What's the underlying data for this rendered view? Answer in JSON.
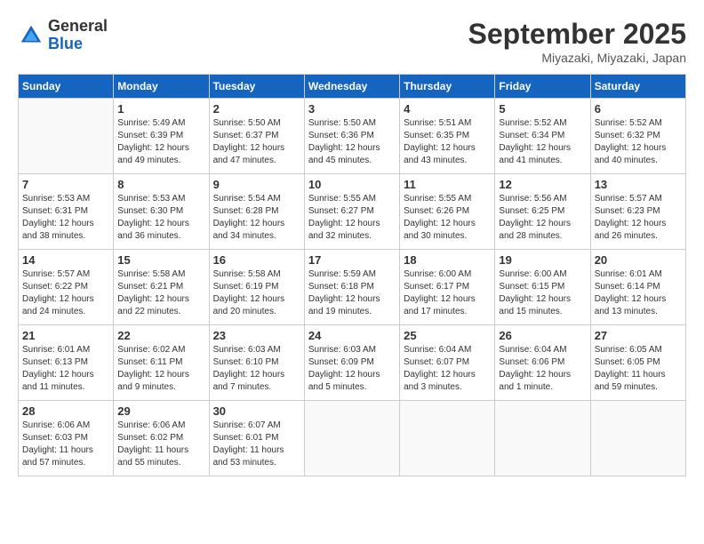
{
  "header": {
    "logo_general": "General",
    "logo_blue": "Blue",
    "month_title": "September 2025",
    "location": "Miyazaki, Miyazaki, Japan"
  },
  "weekdays": [
    "Sunday",
    "Monday",
    "Tuesday",
    "Wednesday",
    "Thursday",
    "Friday",
    "Saturday"
  ],
  "weeks": [
    [
      {
        "day": "",
        "info": ""
      },
      {
        "day": "1",
        "info": "Sunrise: 5:49 AM\nSunset: 6:39 PM\nDaylight: 12 hours\nand 49 minutes."
      },
      {
        "day": "2",
        "info": "Sunrise: 5:50 AM\nSunset: 6:37 PM\nDaylight: 12 hours\nand 47 minutes."
      },
      {
        "day": "3",
        "info": "Sunrise: 5:50 AM\nSunset: 6:36 PM\nDaylight: 12 hours\nand 45 minutes."
      },
      {
        "day": "4",
        "info": "Sunrise: 5:51 AM\nSunset: 6:35 PM\nDaylight: 12 hours\nand 43 minutes."
      },
      {
        "day": "5",
        "info": "Sunrise: 5:52 AM\nSunset: 6:34 PM\nDaylight: 12 hours\nand 41 minutes."
      },
      {
        "day": "6",
        "info": "Sunrise: 5:52 AM\nSunset: 6:32 PM\nDaylight: 12 hours\nand 40 minutes."
      }
    ],
    [
      {
        "day": "7",
        "info": "Sunrise: 5:53 AM\nSunset: 6:31 PM\nDaylight: 12 hours\nand 38 minutes."
      },
      {
        "day": "8",
        "info": "Sunrise: 5:53 AM\nSunset: 6:30 PM\nDaylight: 12 hours\nand 36 minutes."
      },
      {
        "day": "9",
        "info": "Sunrise: 5:54 AM\nSunset: 6:28 PM\nDaylight: 12 hours\nand 34 minutes."
      },
      {
        "day": "10",
        "info": "Sunrise: 5:55 AM\nSunset: 6:27 PM\nDaylight: 12 hours\nand 32 minutes."
      },
      {
        "day": "11",
        "info": "Sunrise: 5:55 AM\nSunset: 6:26 PM\nDaylight: 12 hours\nand 30 minutes."
      },
      {
        "day": "12",
        "info": "Sunrise: 5:56 AM\nSunset: 6:25 PM\nDaylight: 12 hours\nand 28 minutes."
      },
      {
        "day": "13",
        "info": "Sunrise: 5:57 AM\nSunset: 6:23 PM\nDaylight: 12 hours\nand 26 minutes."
      }
    ],
    [
      {
        "day": "14",
        "info": "Sunrise: 5:57 AM\nSunset: 6:22 PM\nDaylight: 12 hours\nand 24 minutes."
      },
      {
        "day": "15",
        "info": "Sunrise: 5:58 AM\nSunset: 6:21 PM\nDaylight: 12 hours\nand 22 minutes."
      },
      {
        "day": "16",
        "info": "Sunrise: 5:58 AM\nSunset: 6:19 PM\nDaylight: 12 hours\nand 20 minutes."
      },
      {
        "day": "17",
        "info": "Sunrise: 5:59 AM\nSunset: 6:18 PM\nDaylight: 12 hours\nand 19 minutes."
      },
      {
        "day": "18",
        "info": "Sunrise: 6:00 AM\nSunset: 6:17 PM\nDaylight: 12 hours\nand 17 minutes."
      },
      {
        "day": "19",
        "info": "Sunrise: 6:00 AM\nSunset: 6:15 PM\nDaylight: 12 hours\nand 15 minutes."
      },
      {
        "day": "20",
        "info": "Sunrise: 6:01 AM\nSunset: 6:14 PM\nDaylight: 12 hours\nand 13 minutes."
      }
    ],
    [
      {
        "day": "21",
        "info": "Sunrise: 6:01 AM\nSunset: 6:13 PM\nDaylight: 12 hours\nand 11 minutes."
      },
      {
        "day": "22",
        "info": "Sunrise: 6:02 AM\nSunset: 6:11 PM\nDaylight: 12 hours\nand 9 minutes."
      },
      {
        "day": "23",
        "info": "Sunrise: 6:03 AM\nSunset: 6:10 PM\nDaylight: 12 hours\nand 7 minutes."
      },
      {
        "day": "24",
        "info": "Sunrise: 6:03 AM\nSunset: 6:09 PM\nDaylight: 12 hours\nand 5 minutes."
      },
      {
        "day": "25",
        "info": "Sunrise: 6:04 AM\nSunset: 6:07 PM\nDaylight: 12 hours\nand 3 minutes."
      },
      {
        "day": "26",
        "info": "Sunrise: 6:04 AM\nSunset: 6:06 PM\nDaylight: 12 hours\nand 1 minute."
      },
      {
        "day": "27",
        "info": "Sunrise: 6:05 AM\nSunset: 6:05 PM\nDaylight: 11 hours\nand 59 minutes."
      }
    ],
    [
      {
        "day": "28",
        "info": "Sunrise: 6:06 AM\nSunset: 6:03 PM\nDaylight: 11 hours\nand 57 minutes."
      },
      {
        "day": "29",
        "info": "Sunrise: 6:06 AM\nSunset: 6:02 PM\nDaylight: 11 hours\nand 55 minutes."
      },
      {
        "day": "30",
        "info": "Sunrise: 6:07 AM\nSunset: 6:01 PM\nDaylight: 11 hours\nand 53 minutes."
      },
      {
        "day": "",
        "info": ""
      },
      {
        "day": "",
        "info": ""
      },
      {
        "day": "",
        "info": ""
      },
      {
        "day": "",
        "info": ""
      }
    ]
  ]
}
